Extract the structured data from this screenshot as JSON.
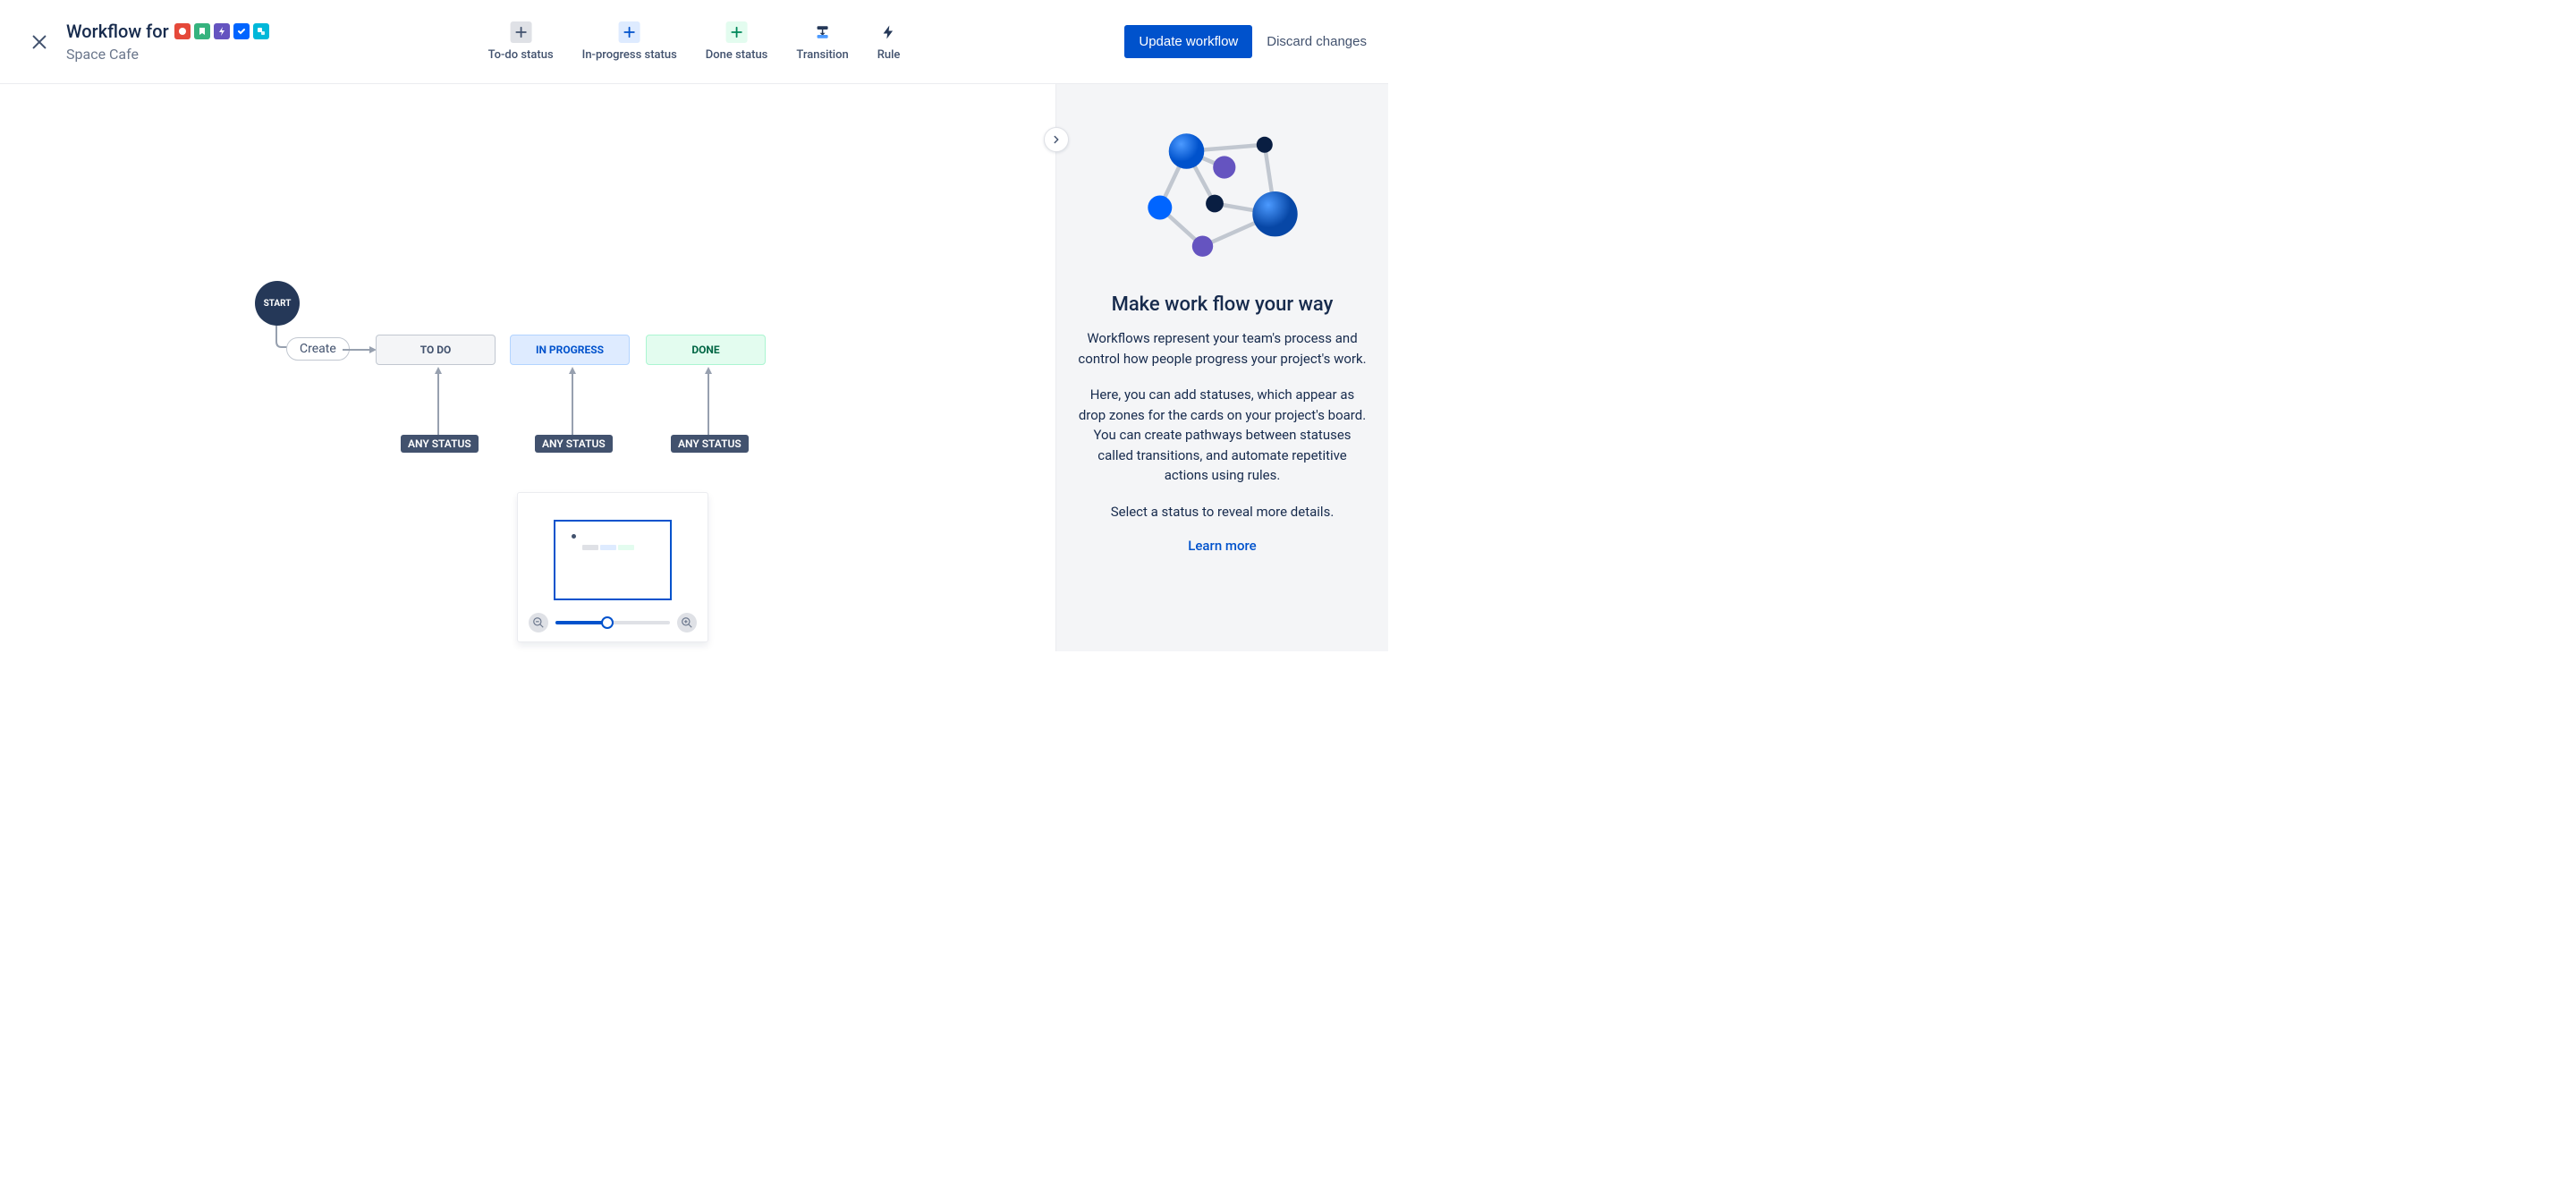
{
  "header": {
    "title_prefix": "Workflow for",
    "project_name": "Space Cafe"
  },
  "toolbar": {
    "todo_status": "To-do status",
    "inprogress_status": "In-progress status",
    "done_status": "Done status",
    "transition": "Transition",
    "rule": "Rule"
  },
  "actions": {
    "primary": "Update workflow",
    "discard": "Discard changes"
  },
  "canvas": {
    "start_label": "START",
    "create_label": "Create",
    "statuses": {
      "todo": "TO DO",
      "in_progress": "IN PROGRESS",
      "done": "DONE"
    },
    "any_status": "ANY STATUS"
  },
  "panel": {
    "title": "Make work flow your way",
    "p1": "Workflows represent your team's process and control how people progress your project's work.",
    "p2": "Here, you can add statuses, which appear as drop zones for the cards on your project's board. You can create pathways between statuses called transitions, and automate repetitive actions using rules.",
    "p3": "Select a status to reveal more details.",
    "learn_more": "Learn more"
  },
  "minimap": {
    "zoom_percent": 45
  }
}
